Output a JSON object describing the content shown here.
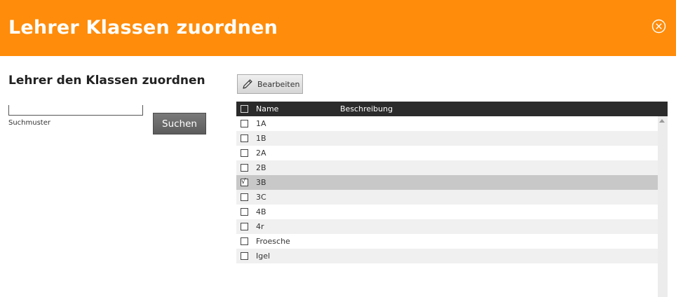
{
  "header": {
    "title": "Lehrer Klassen zuordnen",
    "close_icon": "close-circle-icon"
  },
  "left": {
    "title": "Lehrer den Klassen zuordnen",
    "search_value": "",
    "search_label": "Suchmuster",
    "search_button": "Suchen"
  },
  "toolbar": {
    "edit_label": "Bearbeiten",
    "edit_icon": "pencil-icon"
  },
  "grid": {
    "columns": {
      "name": "Name",
      "description": "Beschreibung"
    },
    "rows": [
      {
        "name": "1A",
        "checked": false
      },
      {
        "name": "1B",
        "checked": false
      },
      {
        "name": "2A",
        "checked": false
      },
      {
        "name": "2B",
        "checked": false
      },
      {
        "name": "3B",
        "checked": true
      },
      {
        "name": "3C",
        "checked": false
      },
      {
        "name": "4B",
        "checked": false
      },
      {
        "name": "4r",
        "checked": false
      },
      {
        "name": "Froesche",
        "checked": false
      },
      {
        "name": "Igel",
        "checked": false
      }
    ]
  },
  "colors": {
    "header": "#ff8c0a",
    "grid_header": "#2b2b2b",
    "selected_row": "#c8c8c8"
  }
}
